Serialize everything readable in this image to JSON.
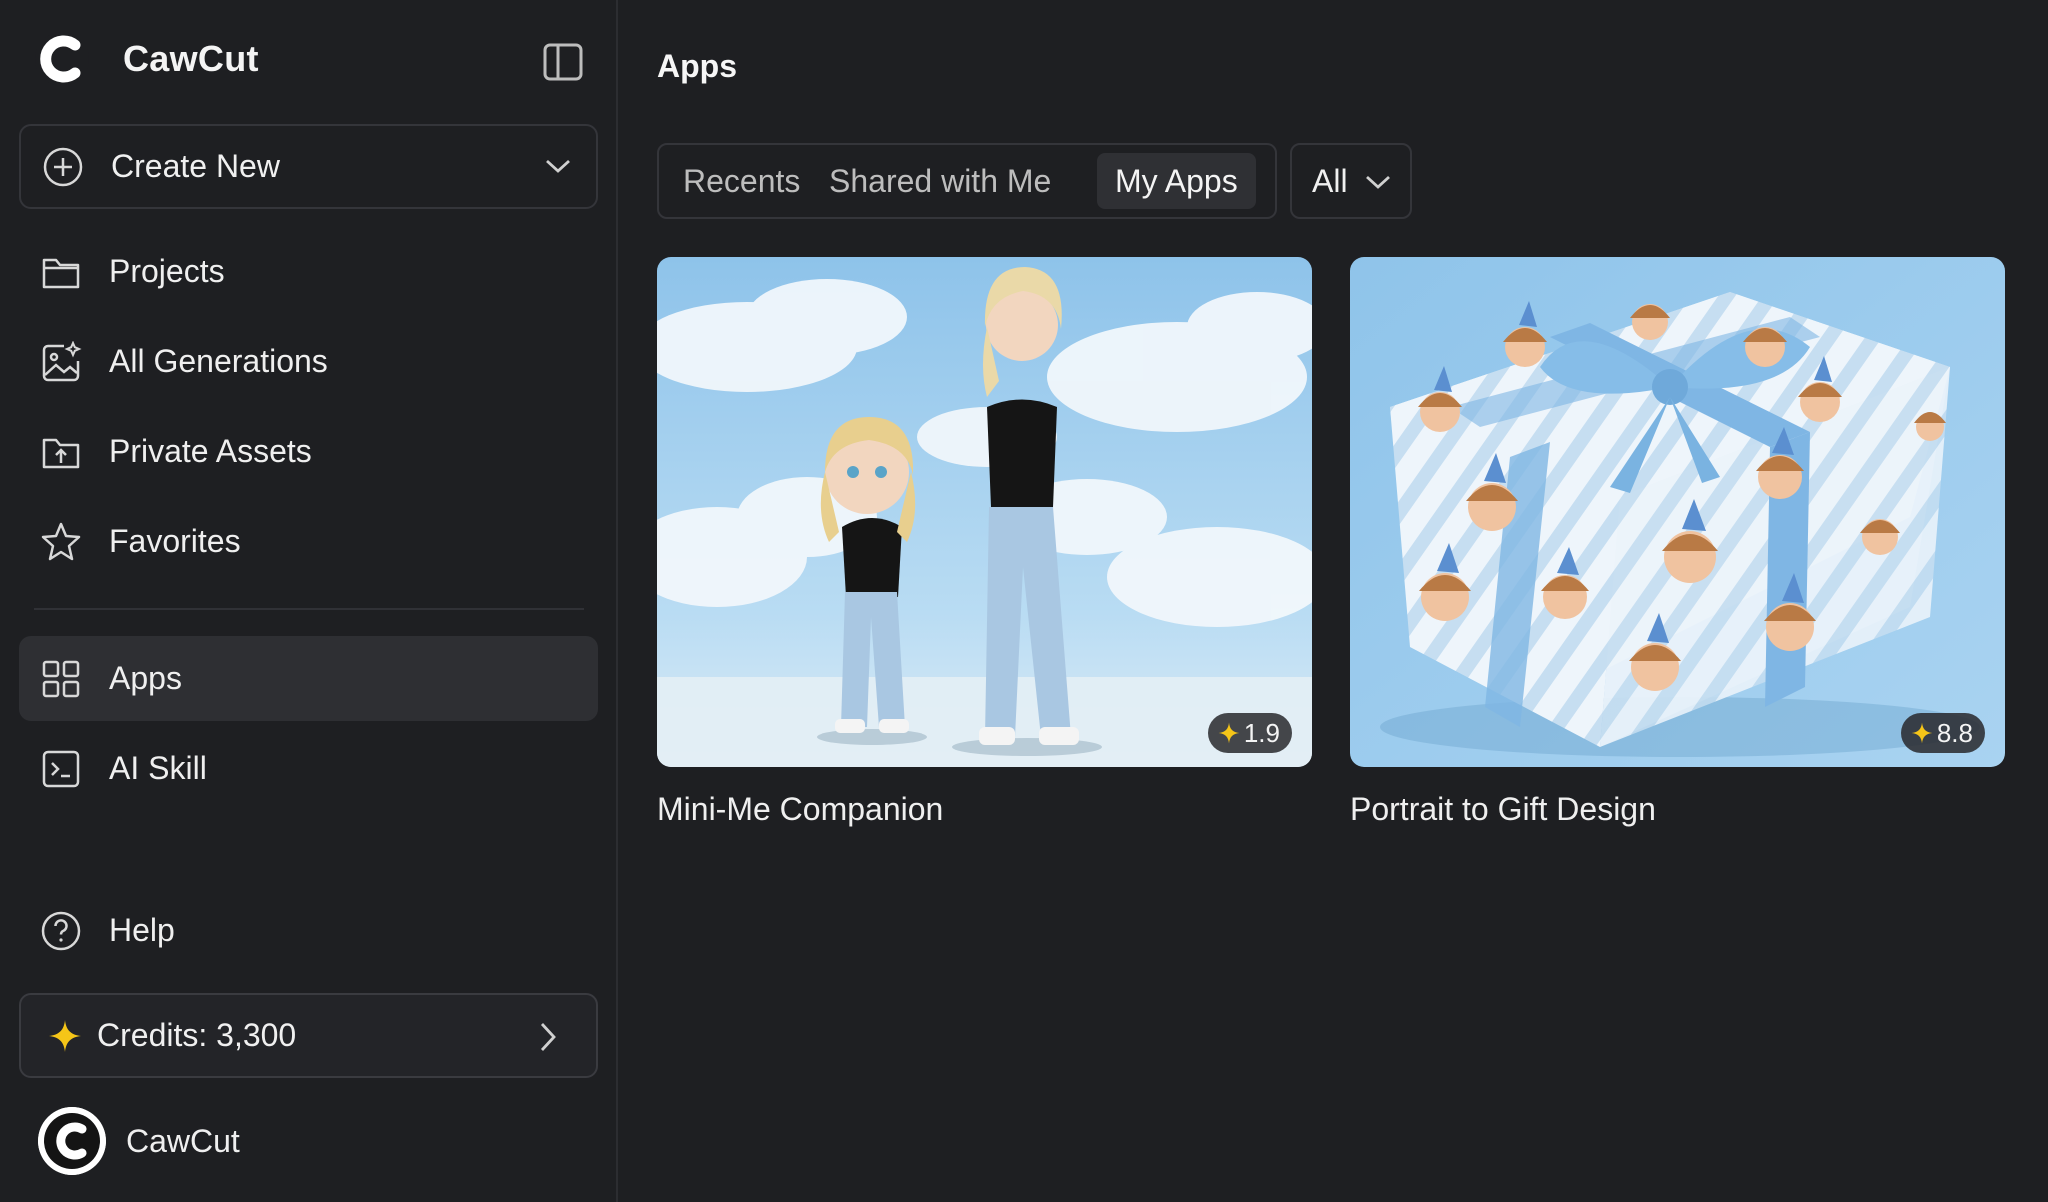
{
  "brand": {
    "name": "CawCut"
  },
  "sidebar": {
    "create_new": "Create New",
    "items": [
      {
        "label": "Projects",
        "icon": "folder-icon"
      },
      {
        "label": "All Generations",
        "icon": "image-sparkle-icon"
      },
      {
        "label": "Private Assets",
        "icon": "folder-upload-icon"
      },
      {
        "label": "Favorites",
        "icon": "star-icon"
      },
      {
        "label": "Apps",
        "icon": "grid-icon",
        "active": true
      },
      {
        "label": "AI Skill",
        "icon": "terminal-icon"
      },
      {
        "label": "Help",
        "icon": "help-icon"
      }
    ],
    "credits": "Credits: 3,300",
    "user_name": "CawCut"
  },
  "main": {
    "title": "Apps",
    "tabs": [
      {
        "label": "Recents"
      },
      {
        "label": "Shared with Me"
      },
      {
        "label": "My Apps",
        "active": true
      }
    ],
    "filter": "All",
    "cards": [
      {
        "title": "Mini-Me Companion",
        "rating": "1.9"
      },
      {
        "title": "Portrait to Gift Design",
        "rating": "8.8"
      }
    ]
  },
  "colors": {
    "background": "#1e1f22",
    "active_item": "#2e2f33",
    "accent_star": "#f5c518"
  }
}
